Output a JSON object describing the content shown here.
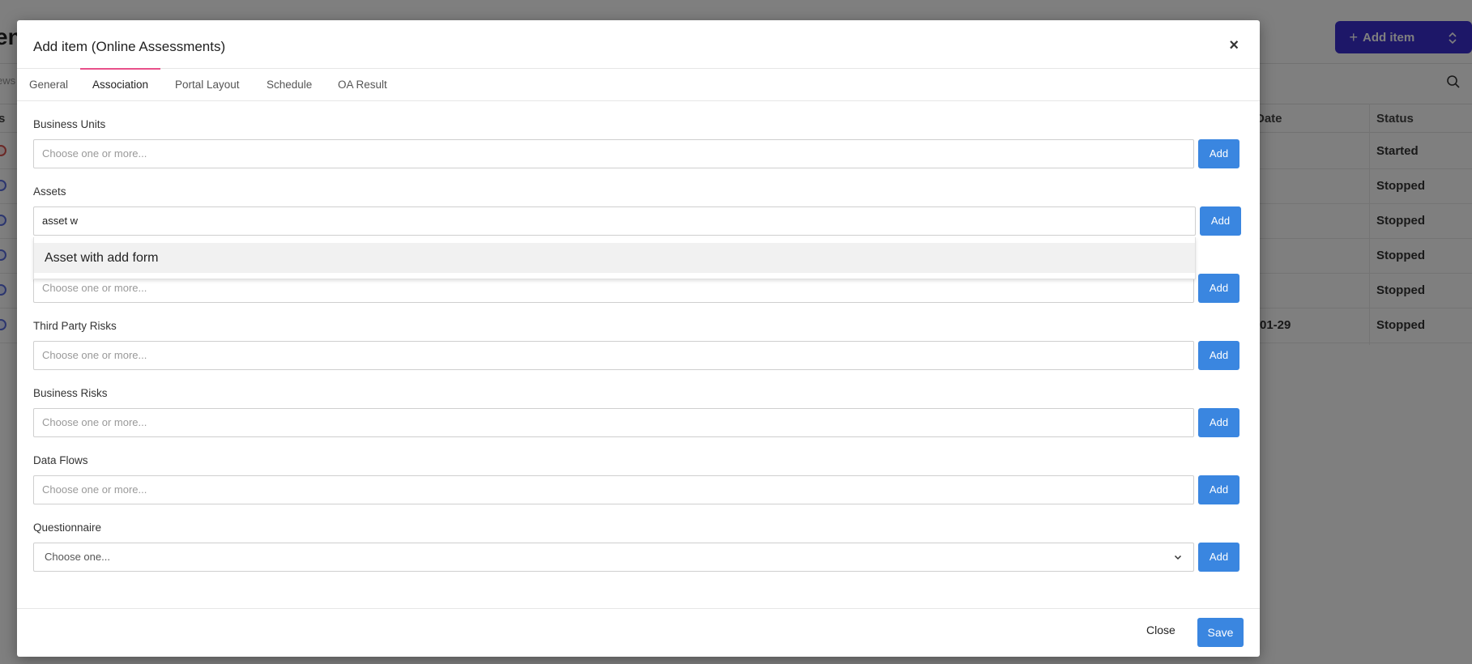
{
  "background": {
    "page_title_fragment": "en",
    "views_fragment": "ews",
    "add_item_label": "Add item",
    "add_item_toggle_icon": "chevron-updown-icon",
    "search_icon": "search-icon",
    "table": {
      "headers": {
        "first": "s",
        "date": "Date",
        "status": "Status"
      },
      "rows": [
        {
          "date": "",
          "status": "Started"
        },
        {
          "date": "",
          "status": "Stopped"
        },
        {
          "date": "",
          "status": "Stopped"
        },
        {
          "date": "",
          "status": "Stopped"
        },
        {
          "date": "",
          "status": "Stopped"
        },
        {
          "date": "-01-29",
          "status": "Stopped"
        }
      ]
    }
  },
  "modal": {
    "title": "Add item (Online Assessments)",
    "close_symbol": "×",
    "tabs": [
      {
        "label": "General",
        "active": false
      },
      {
        "label": "Association",
        "active": true
      },
      {
        "label": "Portal Layout",
        "active": false
      },
      {
        "label": "Schedule",
        "active": false
      },
      {
        "label": "OA Result",
        "active": false
      }
    ],
    "fields": {
      "business_units": {
        "label": "Business Units",
        "placeholder": "Choose one or more...",
        "add": "Add"
      },
      "assets": {
        "label": "Assets",
        "value": "asset w",
        "add": "Add",
        "dropdown_option": "Asset with add form"
      },
      "hidden_field": {
        "placeholder": "Choose one or more...",
        "add": "Add"
      },
      "third_party_risks": {
        "label": "Third Party Risks",
        "placeholder": "Choose one or more...",
        "add": "Add"
      },
      "business_risks": {
        "label": "Business Risks",
        "placeholder": "Choose one or more...",
        "add": "Add"
      },
      "data_flows": {
        "label": "Data Flows",
        "placeholder": "Choose one or more...",
        "add": "Add"
      },
      "questionnaire": {
        "label": "Questionnaire",
        "placeholder": "Choose one...",
        "add": "Add"
      }
    },
    "footer": {
      "close": "Close",
      "save": "Save"
    },
    "accent_color": "#e8508a",
    "button_color": "#3a86e0"
  }
}
